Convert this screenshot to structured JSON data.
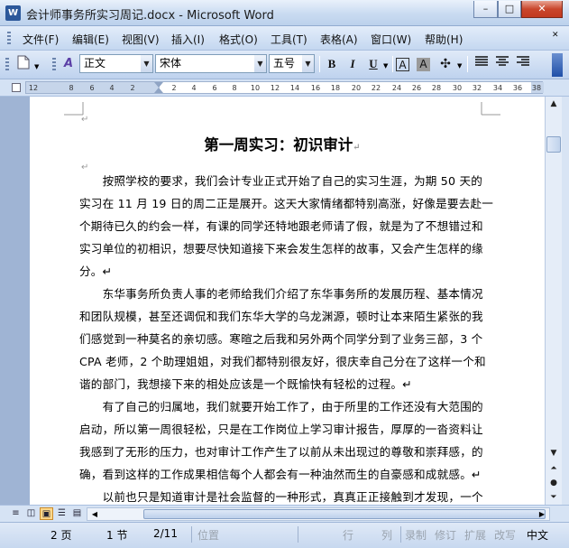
{
  "window": {
    "title": "会计师事务所实习周记.docx - Microsoft Word",
    "app_icon": "W",
    "controls": {
      "minimize": "–",
      "maximize": "□",
      "close": "✕"
    }
  },
  "menu": {
    "items": [
      "文件(F)",
      "编辑(E)",
      "视图(V)",
      "插入(I)",
      "格式(O)",
      "工具(T)",
      "表格(A)",
      "窗口(W)",
      "帮助(H)"
    ]
  },
  "toolbar": {
    "style_value": "正文",
    "font_value": "宋体",
    "size_value": "五号",
    "bold": "B",
    "italic": "I",
    "underline": "U",
    "char_border": "A",
    "char_shading": "A"
  },
  "ruler": {
    "numbers": [
      "12",
      "8",
      "6",
      "4",
      "2",
      "2",
      "4",
      "6",
      "8",
      "10",
      "12",
      "14",
      "16",
      "18",
      "20",
      "22",
      "24",
      "26",
      "28",
      "30",
      "32",
      "34",
      "36",
      "38"
    ]
  },
  "document": {
    "title": "第一周实习：初识审计",
    "lines": [
      "　　按照学校的要求，我们会计专业正式开始了自己的实习生涯，为期 50 天的",
      "实习在 11 月 19 日的周二正是展开。这天大家情绪都特别高涨，好像是要去赴一",
      "个期待已久的约会一样，有课的同学还特地跟老师请了假，就是为了不想错过和",
      "实习单位的初相识，想要尽快知道接下来会发生怎样的故事，又会产生怎样的缘",
      "分。↵",
      "　　东华事务所负责人事的老师给我们介绍了东华事务所的发展历程、基本情况",
      "和团队规模，甚至还调侃和我们东华大学的乌龙渊源，顿时让本来陌生紧张的我",
      "们感觉到一种莫名的亲切感。寒暄之后我和另外两个同学分到了业务三部，3 个",
      "CPA 老师，2 个助理姐姐，对我们都特别很友好，很庆幸自己分在了这样一个和",
      "谐的部门，我想接下来的相处应该是一个既愉快有轻松的过程。↵",
      "　　有了自己的归属地，我们就要开始工作了，由于所里的工作还没有大范围的",
      "启动，所以第一周很轻松，只是在工作岗位上学习审计报告，厚厚的一沓资料让",
      "我感到了无形的压力，也对审计工作产生了以前从未出现过的尊敬和崇拜感，的",
      "确，看到这样的工作成果相信每个人都会有一种油然而生的自豪感和成就感。↵",
      "　　以前也只是知道审计是社会监督的一种形式，真真正正接触到才发现，一个"
    ]
  },
  "statusbar": {
    "page": "2 页",
    "section": "1 节",
    "pages": "2/11",
    "position": "位置",
    "row": "行",
    "col": "列",
    "rec": "录制",
    "trk": "修订",
    "ext": "扩展",
    "ovr": "改写",
    "lang": "中文"
  }
}
